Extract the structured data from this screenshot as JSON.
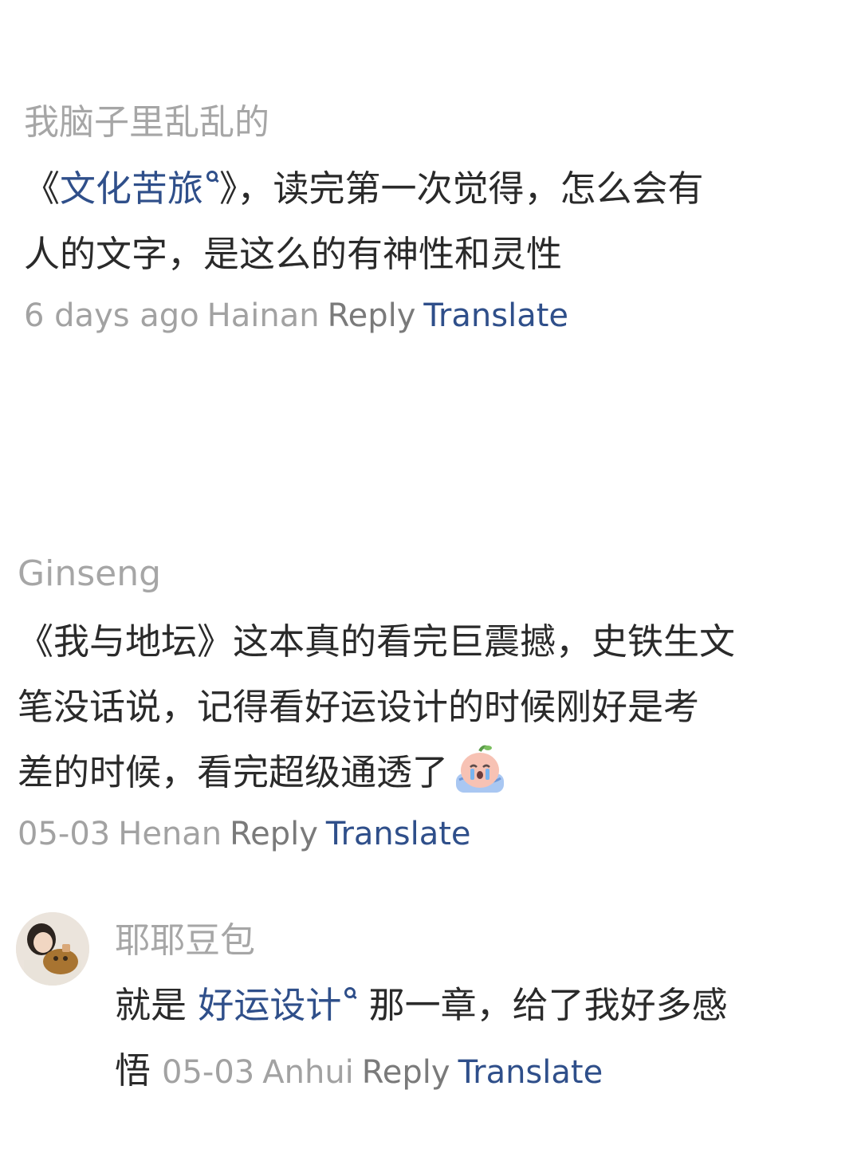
{
  "comments": [
    {
      "author": "我脑子里乱乱的",
      "text_parts": {
        "open_bracket": "《",
        "link": "文化苦旅",
        "rest_line1": "》，读完第一次觉得，怎么会有",
        "line2": "人的文字，是这么的有神性和灵性"
      },
      "time": "6 days ago",
      "location": "Hainan",
      "reply_label": "Reply",
      "translate_label": "Translate"
    },
    {
      "author": "Ginseng",
      "lines": [
        "《我与地坛》这本真的看完巨震撼，史铁生文",
        "笔没话说，记得看好运设计的时候刚好是考",
        "差的时候，看完超级通透了"
      ],
      "emoji": "crying-emoji",
      "time": "05-03",
      "location": "Henan",
      "reply_label": "Reply",
      "translate_label": "Translate"
    },
    {
      "author": "耶耶豆包",
      "text_parts": {
        "prefix": "就是 ",
        "link": "好运设计",
        "rest_line1": " 那一章，给了我好多感",
        "line2": "悟"
      },
      "time": "05-03",
      "location": "Anhui",
      "reply_label": "Reply",
      "translate_label": "Translate",
      "avatar": "user-avatar"
    }
  ],
  "colors": {
    "author": "#a6a6a6",
    "text": "#2a2a2a",
    "link": "#2f4f8a",
    "meta": "#a2a2a2",
    "reply": "#7a7a7a"
  }
}
